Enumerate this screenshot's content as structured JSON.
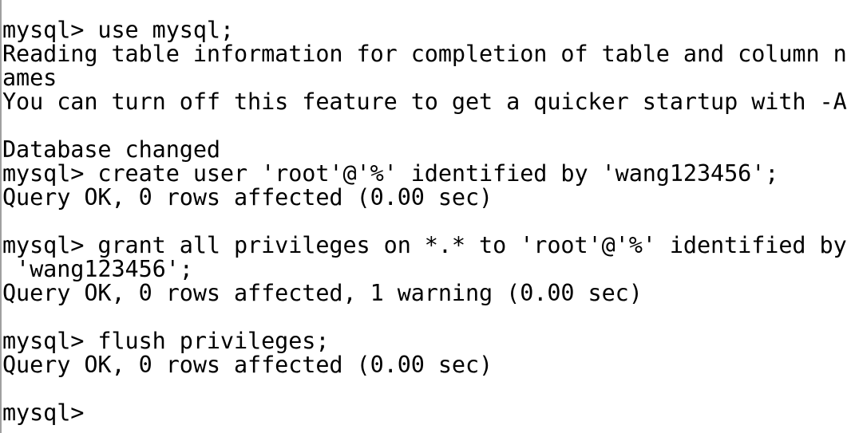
{
  "terminal": {
    "lines": [
      "mysql> use mysql;",
      "Reading table information for completion of table and column n",
      "ames",
      "You can turn off this feature to get a quicker startup with -A",
      "",
      "Database changed",
      "mysql> create user 'root'@'%' identified by 'wang123456';",
      "Query OK, 0 rows affected (0.00 sec)",
      "",
      "mysql> grant all privileges on *.* to 'root'@'%' identified by",
      " 'wang123456';",
      "Query OK, 0 rows affected, 1 warning (0.00 sec)",
      "",
      "mysql> flush privileges;",
      "Query OK, 0 rows affected (0.00 sec)",
      "",
      "mysql>"
    ]
  }
}
